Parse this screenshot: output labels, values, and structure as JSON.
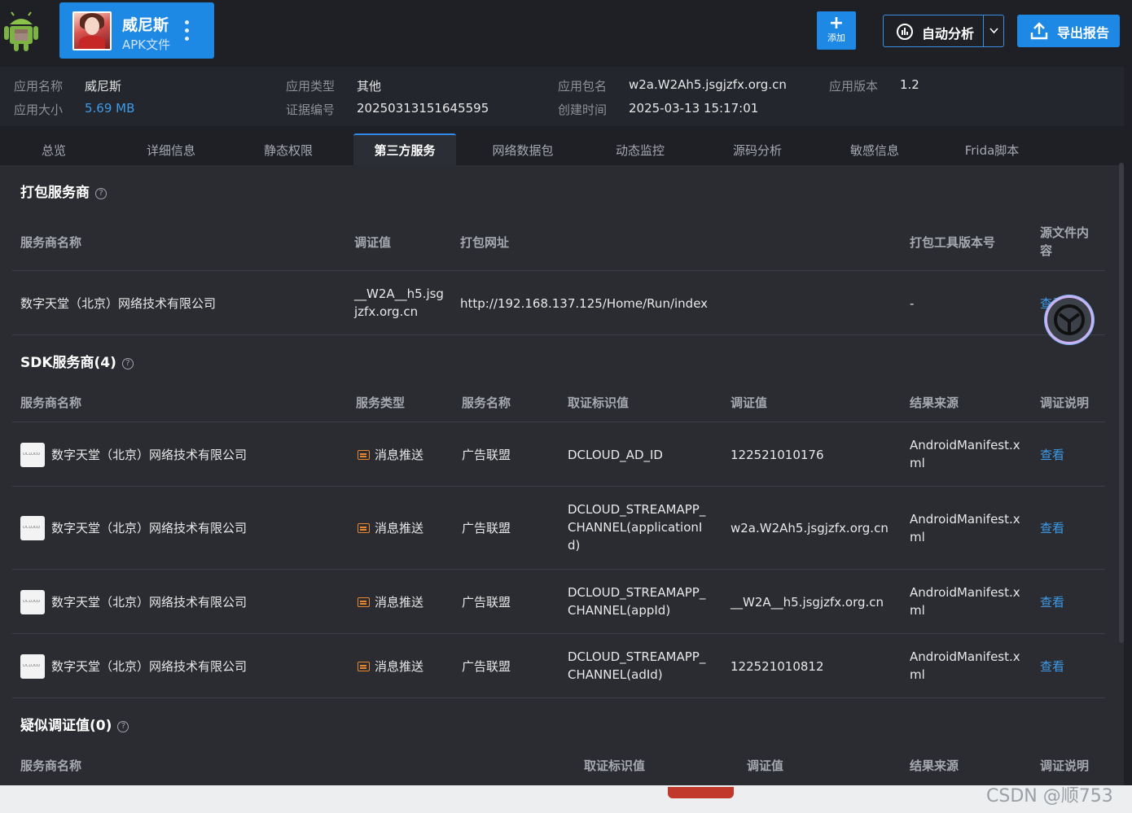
{
  "app": {
    "name": "威尼斯",
    "type_label": "APK文件"
  },
  "toolbar": {
    "add_label": "添加",
    "analyze_label": "自动分析",
    "export_label": "导出报告"
  },
  "info": {
    "app_name_k": "应用名称",
    "app_name_v": "威尼斯",
    "app_size_k": "应用大小",
    "app_size_v": "5.69 MB",
    "app_type_k": "应用类型",
    "app_type_v": "其他",
    "cert_no_k": "证据编号",
    "cert_no_v": "20250313151645595",
    "package_k": "应用包名",
    "package_v": "w2a.W2Ah5.jsgjzfx.org.cn",
    "created_k": "创建时间",
    "created_v": "2025-03-13 15:17:01",
    "version_k": "应用版本",
    "version_v": "1.2"
  },
  "tabs": [
    "总览",
    "详细信息",
    "静态权限",
    "第三方服务",
    "网络数据包",
    "动态监控",
    "源码分析",
    "敏感信息",
    "Frida脚本"
  ],
  "packer": {
    "title": "打包服务商",
    "headers": {
      "name": "服务商名称",
      "evidence": "调证值",
      "url": "打包网址",
      "tool_version": "打包工具版本号",
      "source_content": "源文件内容"
    },
    "row": {
      "name": "数字天堂（北京）网络技术有限公司",
      "evidence": "__W2A__h5.jsgjzfx.org.cn",
      "url": "http://192.168.137.125/Home/Run/index",
      "tool_version": "-",
      "view": "查看"
    }
  },
  "sdk": {
    "title": "SDK服务商(4)",
    "headers": {
      "name": "服务商名称",
      "service_type": "服务类型",
      "service_name": "服务名称",
      "id_key": "取证标识值",
      "evidence": "调证值",
      "source": "结果来源",
      "desc": "调证说明"
    },
    "rows": [
      {
        "name": "数字天堂（北京）网络技术有限公司",
        "service_type": "消息推送",
        "service_name": "广告联盟",
        "id_key": "DCLOUD_AD_ID",
        "evidence": "122521010176",
        "source": "AndroidManifest.xml",
        "view": "查看"
      },
      {
        "name": "数字天堂（北京）网络技术有限公司",
        "service_type": "消息推送",
        "service_name": "广告联盟",
        "id_key": "DCLOUD_STREAMAPP_CHANNEL(applicationId)",
        "evidence": "w2a.W2Ah5.jsgjzfx.org.cn",
        "source": "AndroidManifest.xml",
        "view": "查看"
      },
      {
        "name": "数字天堂（北京）网络技术有限公司",
        "service_type": "消息推送",
        "service_name": "广告联盟",
        "id_key": "DCLOUD_STREAMAPP_CHANNEL(appId)",
        "evidence": "__W2A__h5.jsgjzfx.org.cn",
        "source": "AndroidManifest.xml",
        "view": "查看"
      },
      {
        "name": "数字天堂（北京）网络技术有限公司",
        "service_type": "消息推送",
        "service_name": "广告联盟",
        "id_key": "DCLOUD_STREAMAPP_CHANNEL(adId)",
        "evidence": "122521010812",
        "source": "AndroidManifest.xml",
        "view": "查看"
      }
    ]
  },
  "suspect": {
    "title": "疑似调证值(0)",
    "headers": {
      "name": "服务商名称",
      "id_key": "取证标识值",
      "evidence": "调证值",
      "source": "结果来源",
      "desc": "调证说明"
    }
  },
  "watermark": "CSDN @顺753",
  "colors": {
    "accent": "#1e88e5",
    "link": "#3d9be9",
    "push_icon": "#e8872d"
  }
}
